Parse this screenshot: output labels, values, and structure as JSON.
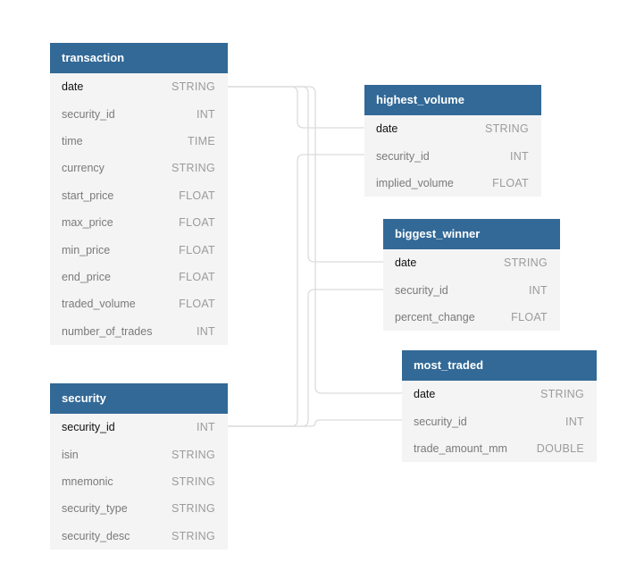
{
  "tables": {
    "transaction": {
      "name": "transaction",
      "fields": [
        {
          "name": "date",
          "type": "STRING"
        },
        {
          "name": "security_id",
          "type": "INT"
        },
        {
          "name": "time",
          "type": "TIME"
        },
        {
          "name": "currency",
          "type": "STRING"
        },
        {
          "name": "start_price",
          "type": "FLOAT"
        },
        {
          "name": "max_price",
          "type": "FLOAT"
        },
        {
          "name": "min_price",
          "type": "FLOAT"
        },
        {
          "name": "end_price",
          "type": "FLOAT"
        },
        {
          "name": "traded_volume",
          "type": "FLOAT"
        },
        {
          "name": "number_of_trades",
          "type": "INT"
        }
      ]
    },
    "security": {
      "name": "security",
      "fields": [
        {
          "name": "security_id",
          "type": "INT"
        },
        {
          "name": "isin",
          "type": "STRING"
        },
        {
          "name": "mnemonic",
          "type": "STRING"
        },
        {
          "name": "security_type",
          "type": "STRING"
        },
        {
          "name": "security_desc",
          "type": "STRING"
        }
      ]
    },
    "highest_volume": {
      "name": "highest_volume",
      "fields": [
        {
          "name": "date",
          "type": "STRING"
        },
        {
          "name": "security_id",
          "type": "INT"
        },
        {
          "name": "implied_volume",
          "type": "FLOAT"
        }
      ]
    },
    "biggest_winner": {
      "name": "biggest_winner",
      "fields": [
        {
          "name": "date",
          "type": "STRING"
        },
        {
          "name": "security_id",
          "type": "INT"
        },
        {
          "name": "percent_change",
          "type": "FLOAT"
        }
      ]
    },
    "most_traded": {
      "name": "most_traded",
      "fields": [
        {
          "name": "date",
          "type": "STRING"
        },
        {
          "name": "security_id",
          "type": "INT"
        },
        {
          "name": "trade_amount_mm",
          "type": "DOUBLE"
        }
      ]
    }
  },
  "relationships": [
    {
      "from": "transaction.date",
      "to": "highest_volume.date"
    },
    {
      "from": "transaction.date",
      "to": "biggest_winner.date"
    },
    {
      "from": "transaction.date",
      "to": "most_traded.date"
    },
    {
      "from": "security.security_id",
      "to": "highest_volume.security_id"
    },
    {
      "from": "security.security_id",
      "to": "biggest_winner.security_id"
    },
    {
      "from": "security.security_id",
      "to": "most_traded.security_id"
    }
  ],
  "colors": {
    "header": "#326997",
    "body": "#f4f4f4",
    "connector": "#dcdcdc"
  }
}
